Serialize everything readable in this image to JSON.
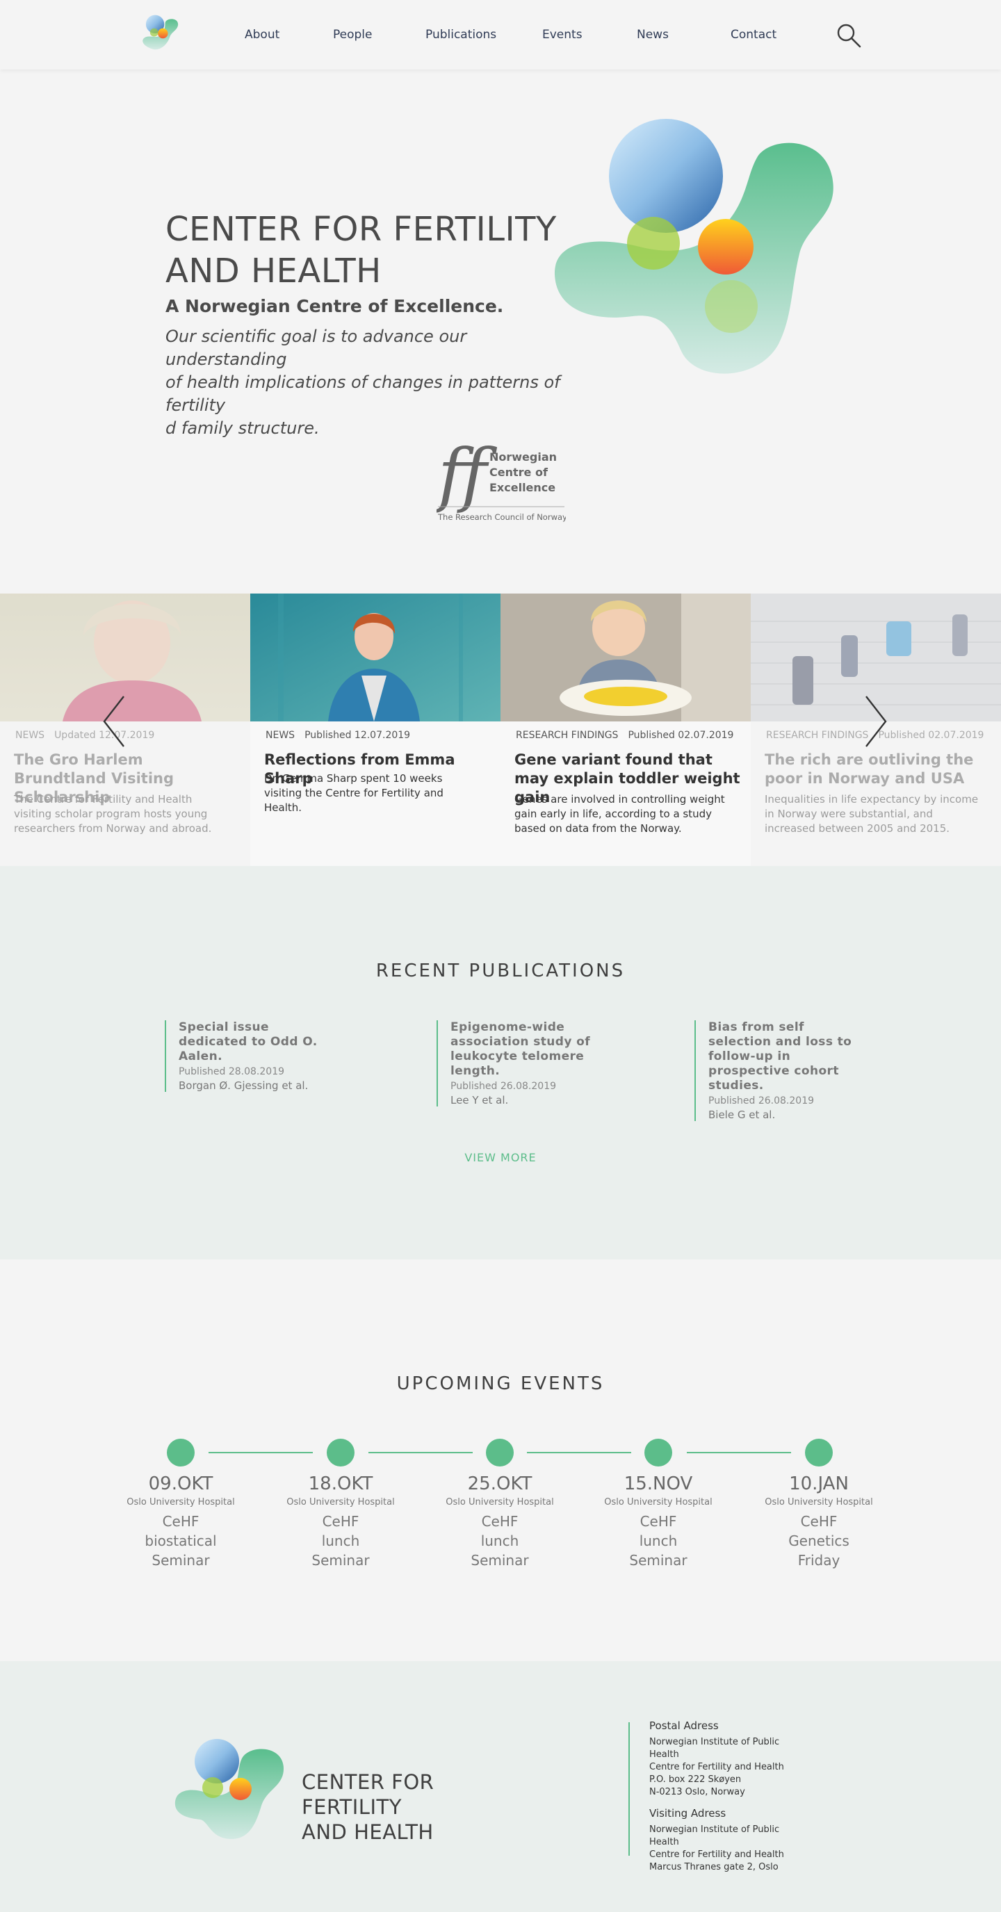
{
  "nav": {
    "items": [
      "About",
      "People",
      "Publications",
      "Events",
      "News",
      "Contact"
    ],
    "search_icon": "search-icon"
  },
  "hero": {
    "title_line1": "CENTER FOR FERTILITY",
    "title_line2": "AND HEALTH",
    "subtitle": "A Norwegian Centre of Excellence.",
    "goal_line1": "Our scientific goal is to advance our understanding",
    "goal_line2": "of health implications of changes in patterns of fertility",
    "goal_line3": "d family structure."
  },
  "badge": {
    "line1": "Norwegian",
    "line2": "Centre of",
    "line3": "Excellence",
    "caption": "The Research Council of Norway"
  },
  "news": [
    {
      "category": "NEWS",
      "date": "Updated 12.07.2019",
      "title": "The Gro Harlem Brundtland Visiting Scholarship",
      "body": "The Centre for Fertility and Health visiting scholar program hosts young researchers from Norway and abroad."
    },
    {
      "category": "NEWS",
      "date": "Published 12.07.2019",
      "title": "Reflections from Emma Sharp",
      "body": "Dr. Gemma Sharp spent 10 weeks visiting the Centre for Fertility and Health."
    },
    {
      "category": "RESEARCH FINDINGS",
      "date": "Published 02.07.2019",
      "title": "Gene variant found that may explain toddler weight gain",
      "body": "Genes are involved in controlling weight gain early in life, according to a study based on data from the Norway."
    },
    {
      "category": "RESEARCH FINDINGS",
      "date": "Published 02.07.2019",
      "title": "The rich are outliving the poor in Norway and USA",
      "body": "Inequalities in life expectancy by income in Norway were substantial, and increased between 2005 and 2015."
    }
  ],
  "publications": {
    "title": "RECENT PUBLICATIONS",
    "view_more": "VIEW MORE",
    "items": [
      {
        "title": "Special issue dedicated to Odd O. Aalen.",
        "date": "Published 28.08.2019",
        "authors": "Borgan Ø. Gjessing et al."
      },
      {
        "title": "Epigenome-wide association study of leukocyte telomere length.",
        "date": "Published 26.08.2019",
        "authors": "Lee Y et al."
      },
      {
        "title": "Bias from self selection and loss to follow-up in prospective cohort studies.",
        "date": "Published 26.08.2019",
        "authors": "Biele G et al."
      }
    ]
  },
  "events": {
    "title": "UPCOMING EVENTS",
    "items": [
      {
        "date": "09.OKT",
        "place": "Oslo University Hospital",
        "name": "CeHF biostatical Seminar"
      },
      {
        "date": "18.OKT",
        "place": "Oslo University Hospital",
        "name": "CeHF lunch Seminar"
      },
      {
        "date": "25.OKT",
        "place": "Oslo University Hospital",
        "name": "CeHF lunch Seminar"
      },
      {
        "date": "15.NOV",
        "place": "Oslo University Hospital",
        "name": "CeHF lunch Seminar"
      },
      {
        "date": "10.JAN",
        "place": "Oslo University Hospital",
        "name": "CeHF Genetics Friday"
      }
    ]
  },
  "footer": {
    "title_line1": "CENTER FOR FERTILITY",
    "title_line2": "AND HEALTH",
    "postal_heading": "Postal Adress",
    "postal_lines": [
      "Norwegian Institute of Public Health",
      "Centre for Fertility and Health",
      "P.O. box 222 Skøyen",
      "N-0213 Oslo, Norway"
    ],
    "visiting_heading": "Visiting Adress",
    "visiting_lines": [
      "Norwegian Institute of Public Health",
      "Centre for Fertility and Health",
      "Marcus Thranes gate 2, Oslo"
    ]
  },
  "colors": {
    "accent_green": "#5cbd8a",
    "text_dark": "#3f3f3f",
    "nav_text": "#2f3b55",
    "section_bg": "#eaefed"
  }
}
